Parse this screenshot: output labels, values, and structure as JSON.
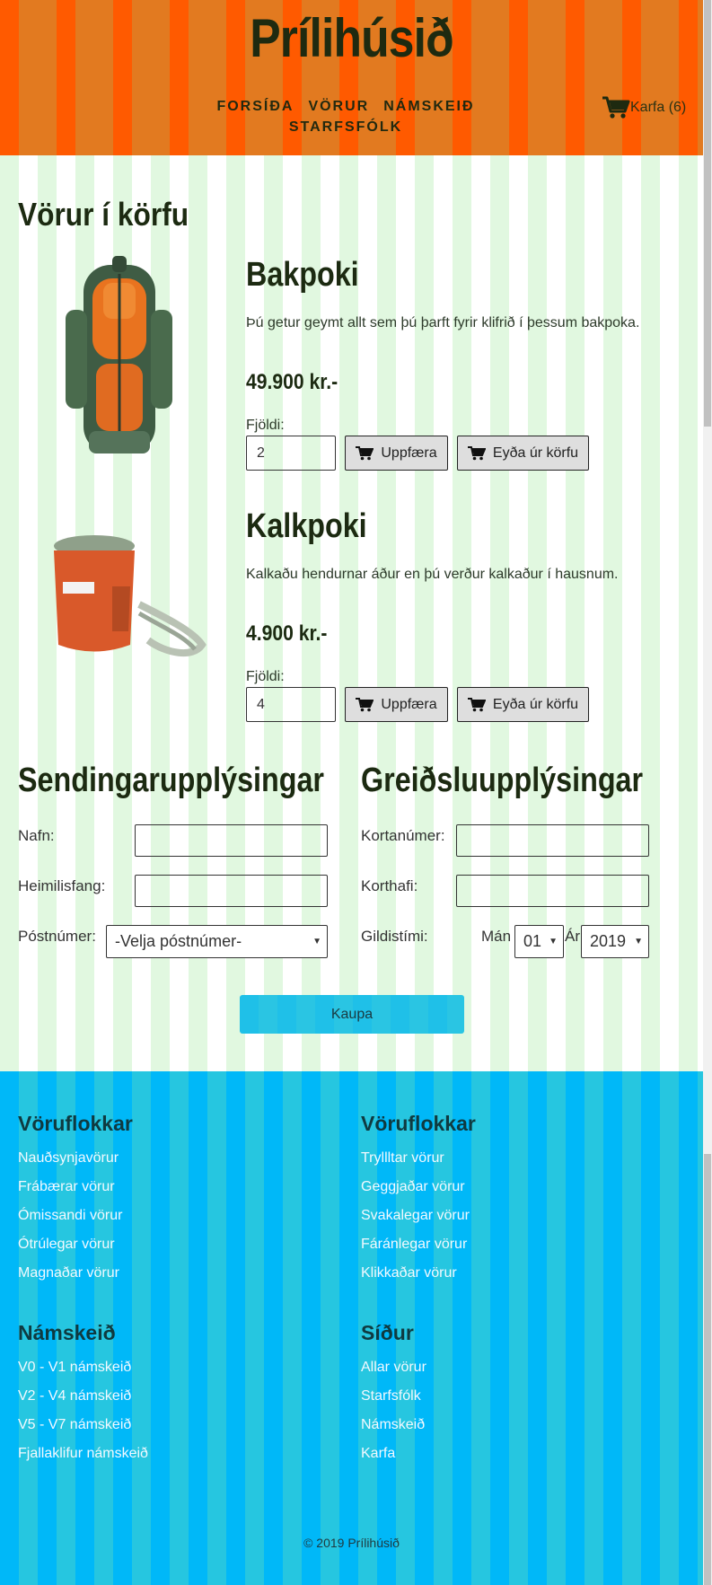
{
  "header": {
    "site_title": "Prílihúsið",
    "nav": [
      "FORSÍÐA",
      "VÖRUR",
      "NÁMSKEIÐ",
      "STARFSFÓLK"
    ],
    "cart_label": "Karfa (6)"
  },
  "cart": {
    "heading": "Vörur í körfu",
    "items": [
      {
        "name": "Bakpoki",
        "description": "Þú getur geymt allt sem þú þarft fyrir klifrið í þessum bakpoka.",
        "price": "49.900 kr.-",
        "qty_label": "Fjöldi:",
        "qty": "2",
        "update_label": "Uppfæra",
        "remove_label": "Eyða úr körfu"
      },
      {
        "name": "Kalkpoki",
        "description": "Kalkaðu hendurnar áður en þú verður kalkaður í hausnum.",
        "price": "4.900 kr.-",
        "qty_label": "Fjöldi:",
        "qty": "4",
        "update_label": "Uppfæra",
        "remove_label": "Eyða úr körfu"
      }
    ]
  },
  "shipping": {
    "heading": "Sendingarupplýsingar",
    "name_label": "Nafn:",
    "address_label": "Heimilisfang:",
    "postal_label": "Póstnúmer:",
    "postal_selected": "-Velja póstnúmer-"
  },
  "payment": {
    "heading": "Greiðsluupplýsingar",
    "card_number_label": "Kortanúmer:",
    "cardholder_label": "Korthafi:",
    "expiry_label": "Gildistími:",
    "month_label": "Mán",
    "month_selected": "01",
    "year_label": "Ár",
    "year_selected": "2019"
  },
  "buy_label": "Kaupa",
  "footer": {
    "col1": {
      "heading": "Vöruflokkar",
      "links": [
        "Nauðsynjavörur",
        "Frábærar vörur",
        "Ómissandi vörur",
        "Ótrúlegar vörur",
        "Magnaðar vörur"
      ]
    },
    "col2": {
      "heading": "Vöruflokkar",
      "links": [
        "Tryllltar vörur",
        "Geggjaðar vörur",
        "Svakalegar vörur",
        "Fáránlegar vörur",
        "Klikkaðar vörur"
      ]
    },
    "col3": {
      "heading": "Námskeið",
      "links": [
        "V0 - V1 námskeið",
        "V2 - V4 námskeið",
        "V5 - V7 námskeið",
        "Fjallaklifur námskeið"
      ]
    },
    "col4": {
      "heading": "Síður",
      "links": [
        "Allar vörur",
        "Starfsfólk",
        "Námskeið",
        "Karfa"
      ]
    },
    "copyright": "© 2019 Prílihúsið"
  },
  "colors": {
    "header_stripe_a": "#ff5a00",
    "header_stripe_b": "#e27a20",
    "main_stripe": "#e1f8e0",
    "footer_stripe_a": "#00b8f8",
    "footer_stripe_b": "#26c6e0",
    "buy_button": "#1fc0e8"
  },
  "icons": {
    "cart": "shopping-cart-icon",
    "select_arrow": "chevron-down-icon"
  }
}
